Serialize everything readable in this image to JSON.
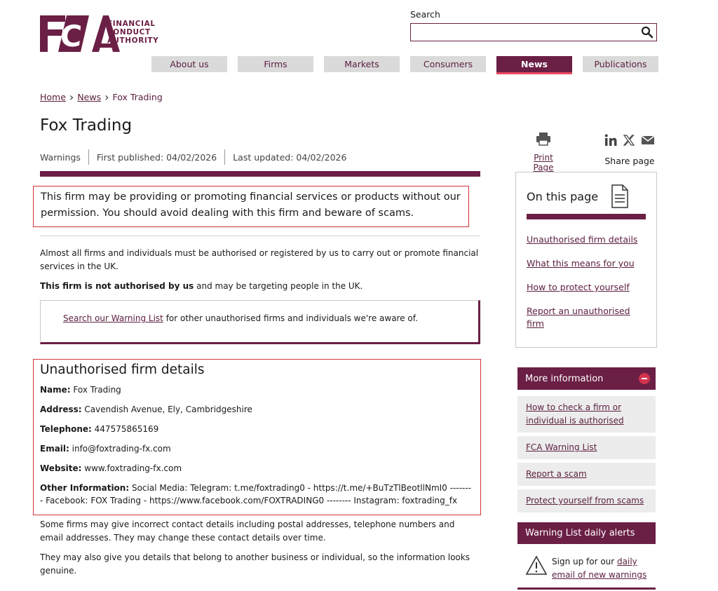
{
  "header": {
    "logo_line1": "FINANCIAL",
    "logo_line2": "CONDUCT",
    "logo_line3": "AUTHORITY",
    "search_label": "Search",
    "search_placeholder": ""
  },
  "nav": [
    {
      "label": "About us"
    },
    {
      "label": "Firms"
    },
    {
      "label": "Markets"
    },
    {
      "label": "Consumers"
    },
    {
      "label": "News"
    },
    {
      "label": "Publications"
    }
  ],
  "breadcrumb": {
    "home": "Home",
    "news": "News",
    "current": "Fox Trading"
  },
  "page": {
    "title": "Fox Trading",
    "category": "Warnings",
    "first_published": "First published: 04/02/2026",
    "last_updated": "Last updated: 04/02/2026"
  },
  "warning_text": "This firm may be providing or promoting financial services or products without our permission. You should avoid dealing with this firm and beware of scams.",
  "intro": {
    "p1": "Almost all firms and individuals must be authorised or registered by us to carry out or promote financial services in the UK.",
    "p2_bold": "This firm is not authorised by us",
    "p2_rest": " and may be targeting people in the UK."
  },
  "warning_list": {
    "link": "Search our Warning List",
    "rest": " for other unauthorised firms and individuals we're aware of."
  },
  "details": {
    "heading": "Unauthorised firm details",
    "name_label": "Name:",
    "name": " Fox Trading",
    "address_label": "Address:",
    "address": " Cavendish Avenue, Ely, Cambridgeshire",
    "telephone_label": "Telephone:",
    "telephone": " 447575865169",
    "email_label": "Email:",
    "email": " info@foxtrading-fx.com",
    "website_label": "Website:",
    "website": " www.foxtrading-fx.com",
    "other_label": "Other Information:",
    "other": " Social Media: Telegram: t.me/foxtrading0 - https://t.me/+BuTzTlBeotllNmI0 -------- Facebook: FOX Trading - https://www.facebook.com/FOXTRADING0 -------- Instagram: foxtrading_fx"
  },
  "footer_text": {
    "p1": "Some firms may give incorrect contact details including postal addresses, telephone numbers and email addresses. They may change these contact details over time.",
    "p2": "They may also give you details that belong to another business or individual, so the information looks genuine."
  },
  "sidebar": {
    "print_label": "Print Page",
    "share_label": "Share page",
    "on_this_page": "On this page",
    "otp_links": [
      "Unauthorised firm details",
      "What this means for you",
      "How to protect yourself",
      "Report an unauthorised firm"
    ],
    "more_info": "More information",
    "more_links": [
      "How to check a firm or individual is authorised",
      "FCA Warning List",
      "Report a scam",
      "Protect yourself from scams"
    ],
    "alerts_title": "Warning List daily alerts",
    "signup_text": "Sign up for our ",
    "signup_link": "daily email of new warnings"
  },
  "icons": {
    "search": "search-icon",
    "print": "printer-icon",
    "linkedin": "linkedin-icon",
    "x": "x-icon",
    "email": "email-icon",
    "document": "document-icon",
    "collapse": "minus-circle-icon",
    "warning": "warning-triangle-icon"
  },
  "colors": {
    "brand": "#6b1f45",
    "accent": "#d3334f",
    "alert_border": "#d3333b"
  }
}
